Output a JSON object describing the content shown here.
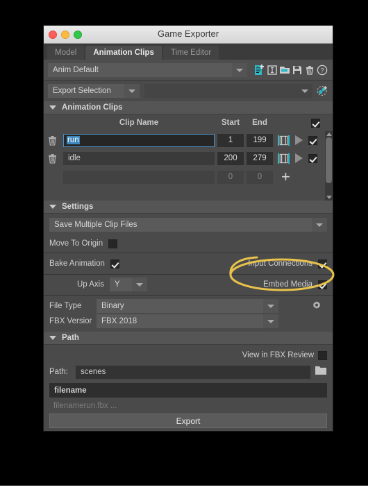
{
  "window": {
    "title": "Game Exporter",
    "traffic_lights": [
      "close-red",
      "minimize-yellow",
      "zoom-green"
    ]
  },
  "tabs": [
    {
      "label": "Model",
      "active": false
    },
    {
      "label": "Animation Clips",
      "active": true
    },
    {
      "label": "Time Editor",
      "active": false
    }
  ],
  "preset": {
    "value": "Anim Default",
    "icons": [
      "new-preset-icon",
      "rename-preset-icon",
      "open-preset-icon",
      "save-preset-icon",
      "delete-preset-icon",
      "help-icon"
    ]
  },
  "export_bar": {
    "mode": "Export Selection",
    "selection_value": "",
    "add_icon": "add-selection-icon"
  },
  "animation_clips": {
    "section_title": "Animation Clips",
    "columns": {
      "clip_name": "Clip Name",
      "start": "Start",
      "end": "End",
      "export_all_checked": true
    },
    "rows": [
      {
        "name": "run",
        "start": "1",
        "end": "199",
        "checked": true,
        "selected": true
      },
      {
        "name": "idle",
        "start": "200",
        "end": "279",
        "checked": true,
        "selected": false
      }
    ],
    "new_row": {
      "name": "",
      "start": "0",
      "end": "0",
      "add_label": "+"
    }
  },
  "settings": {
    "section_title": "Settings",
    "save_mode": "Save Multiple Clip Files",
    "move_to_origin": {
      "label": "Move To Origin",
      "checked": false
    },
    "bake_animation": {
      "label": "Bake Animation",
      "checked": true
    },
    "input_connections": {
      "label": "Input Connections",
      "checked": true
    },
    "up_axis": {
      "label": "Up Axis",
      "value": "Y"
    },
    "embed_media": {
      "label": "Embed Media",
      "checked": true
    },
    "file_type": {
      "label": "File Type",
      "value": "Binary"
    },
    "fbx_version": {
      "label": "FBX Versior",
      "value": "FBX 2018"
    },
    "gear_icon": "gear-icon"
  },
  "path": {
    "section_title": "Path",
    "view_in_fbx_review": {
      "label": "View in FBX Review",
      "checked": false
    },
    "path_label": "Path:",
    "path_value": "scenes",
    "folder_icon": "folder-icon",
    "filename_value": "filename",
    "preview_text": "filenamerun.fbx ...",
    "export_label": "Export"
  },
  "annotation": {
    "type": "ellipse-highlight",
    "color": "#e8c24a",
    "targets": "input_connections"
  }
}
